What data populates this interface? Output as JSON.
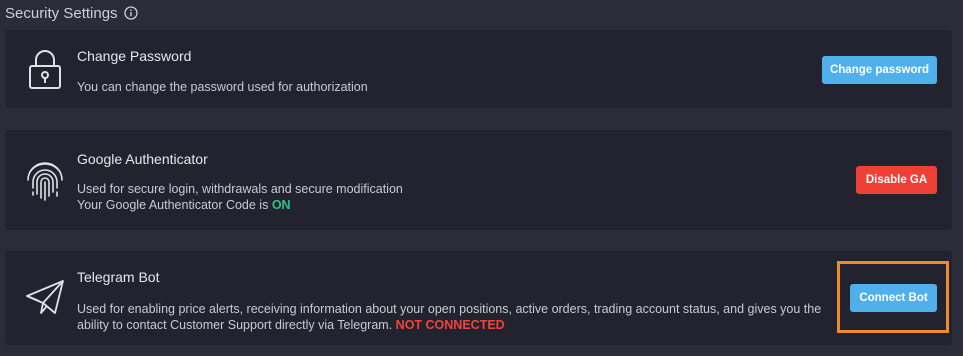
{
  "header": {
    "title": "Security Settings",
    "info_icon": "info-icon"
  },
  "cards": {
    "password": {
      "title": "Change Password",
      "desc": "You can change the password used for authorization",
      "button": "Change password",
      "icon": "lock-icon"
    },
    "ga": {
      "title": "Google Authenticator",
      "desc_line1": "Used for secure login, withdrawals and secure modification",
      "desc_line2": "Your Google Authenticator Code is ",
      "status": "ON",
      "button": "Disable GA",
      "icon": "fingerprint-icon"
    },
    "telegram": {
      "title": "Telegram Bot",
      "desc_line1": "Used for enabling price alerts, receiving information about your open positions, active orders, trading account status, and gives you the",
      "desc_line2": "ability to contact Customer Support directly via Telegram. ",
      "status": "NOT CONNECTED",
      "button": "Connect Bot",
      "icon": "paper-plane-icon"
    }
  },
  "colors": {
    "background": "#2b2b3a",
    "card": "#232330",
    "primary_button": "#4fb0ec",
    "danger_button": "#ef4036",
    "status_on": "#28c587",
    "status_off": "#f0443a",
    "highlight": "#ef8a2b"
  }
}
